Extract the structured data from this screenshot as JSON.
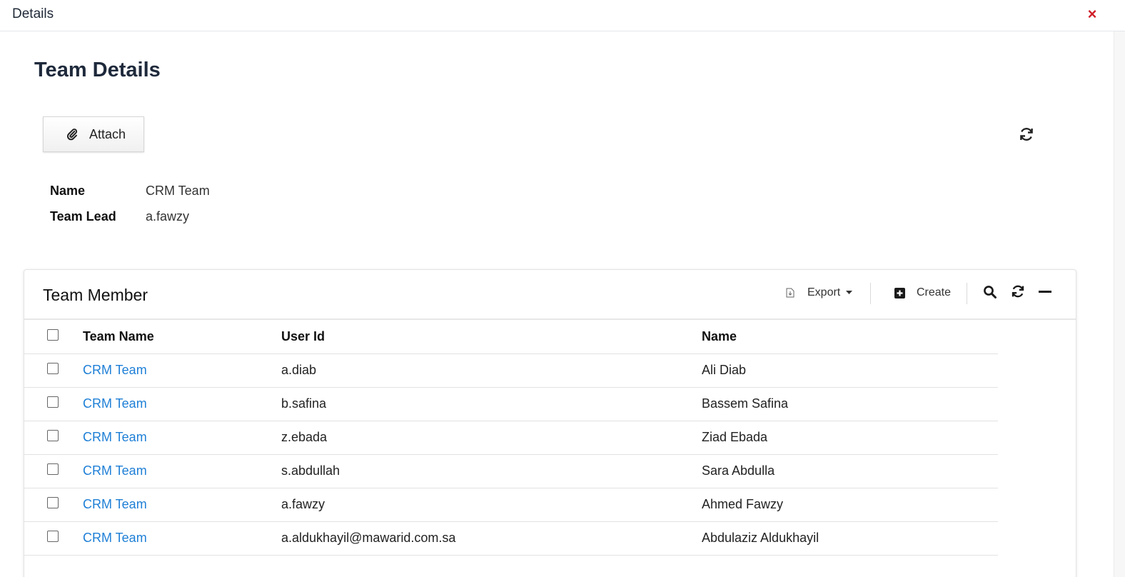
{
  "header": {
    "title": "Details",
    "close_label": "×"
  },
  "page": {
    "title": "Team Details"
  },
  "toolbar": {
    "attach_label": "Attach"
  },
  "details": {
    "name_label": "Name",
    "name_value": "CRM Team",
    "lead_label": "Team Lead",
    "lead_value": "a.fawzy"
  },
  "panel": {
    "title": "Team Member",
    "export_label": "Export",
    "create_label": "Create",
    "columns": {
      "team": "Team Name",
      "user": "User Id",
      "name": "Name"
    },
    "rows": [
      {
        "team": "CRM Team",
        "user": "a.diab",
        "name": "Ali Diab"
      },
      {
        "team": "CRM Team",
        "user": "b.safina",
        "name": "Bassem Safina"
      },
      {
        "team": "CRM Team",
        "user": "z.ebada",
        "name": "Ziad Ebada"
      },
      {
        "team": "CRM Team",
        "user": "s.abdullah",
        "name": "Sara Abdulla"
      },
      {
        "team": "CRM Team",
        "user": "a.fawzy",
        "name": "Ahmed Fawzy"
      },
      {
        "team": "CRM Team",
        "user": "a.aldukhayil@mawarid.com.sa",
        "name": "Abdulaziz Aldukhayil"
      }
    ]
  },
  "colors": {
    "link": "#1e7fd6",
    "close": "#d0202a"
  },
  "icons": [
    "close-icon",
    "paperclip-icon",
    "refresh-icon",
    "file-icon",
    "caret-down-icon",
    "plus-square-icon",
    "search-icon",
    "minus-icon"
  ]
}
